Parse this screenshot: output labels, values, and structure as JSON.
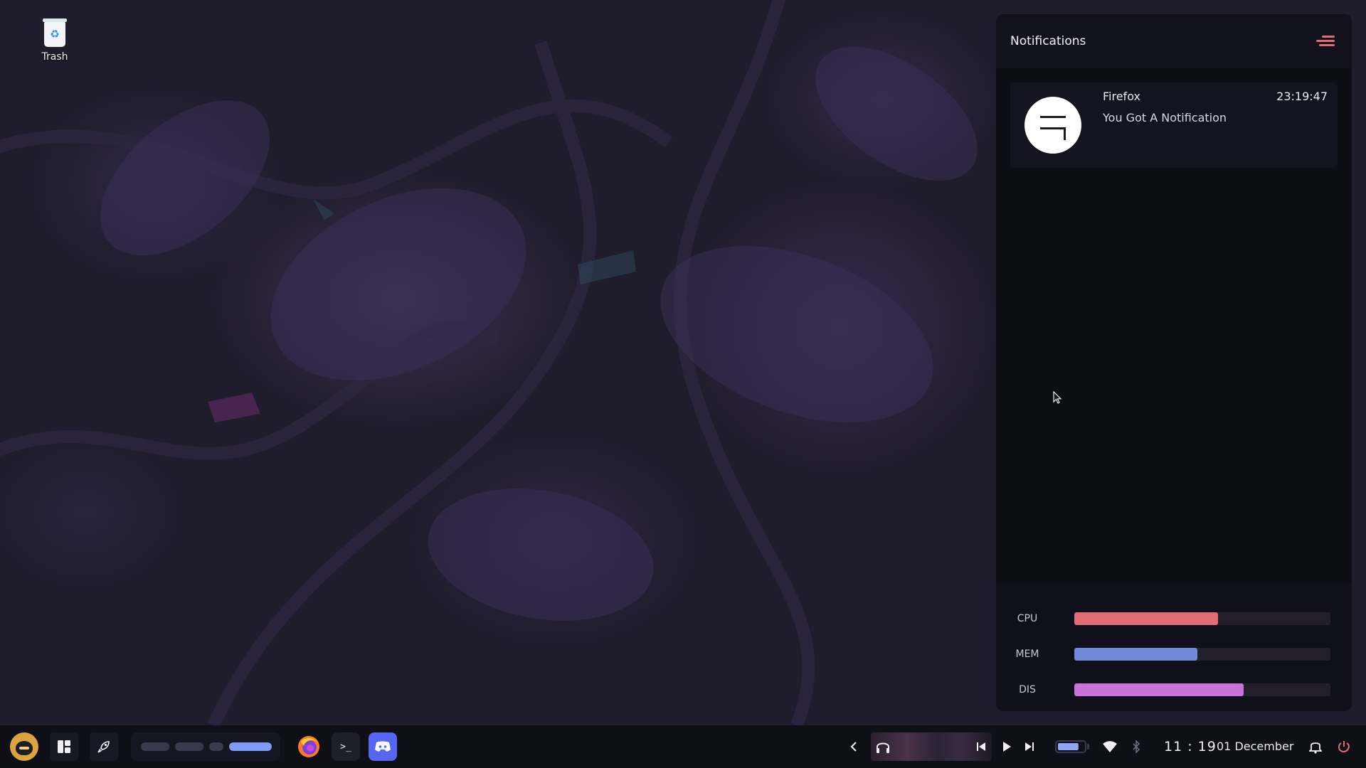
{
  "desktop": {
    "icons": [
      {
        "label": "Trash",
        "icon": "trash-icon"
      }
    ]
  },
  "notifications": {
    "title": "Notifications",
    "clear_icon": "clear-all-icon",
    "accent": "#e06c75",
    "items": [
      {
        "app": "Firefox",
        "time": "23:19:47",
        "body": "You Got A Notification",
        "icon": "app-logo-icon"
      }
    ]
  },
  "stats": [
    {
      "label": "CPU",
      "value": 0.56,
      "color": "#e06c75"
    },
    {
      "label": "MEM",
      "value": 0.48,
      "color": "#7289da"
    },
    {
      "label": "DIS",
      "value": 0.66,
      "color": "#c773d9"
    }
  ],
  "taskbar": {
    "launcher_icon": "layout-grid-icon",
    "rocket_icon": "rocket-icon",
    "workspaces": {
      "count": 4,
      "active_index": 3,
      "active_color": "#7f9cf5"
    },
    "apps": [
      {
        "name": "firefox",
        "icon": "firefox-icon"
      },
      {
        "name": "terminal",
        "icon": "terminal-icon",
        "glyph": ">_"
      },
      {
        "name": "discord",
        "icon": "discord-icon",
        "color": "#5865f2"
      }
    ],
    "media": {
      "icons": [
        "chevron-left-icon",
        "headphones-icon",
        "previous-icon",
        "play-icon",
        "next-icon"
      ]
    },
    "battery_level": 0.8,
    "clock": "11 : 19",
    "date": "01 December",
    "power_color": "#e06c75"
  }
}
